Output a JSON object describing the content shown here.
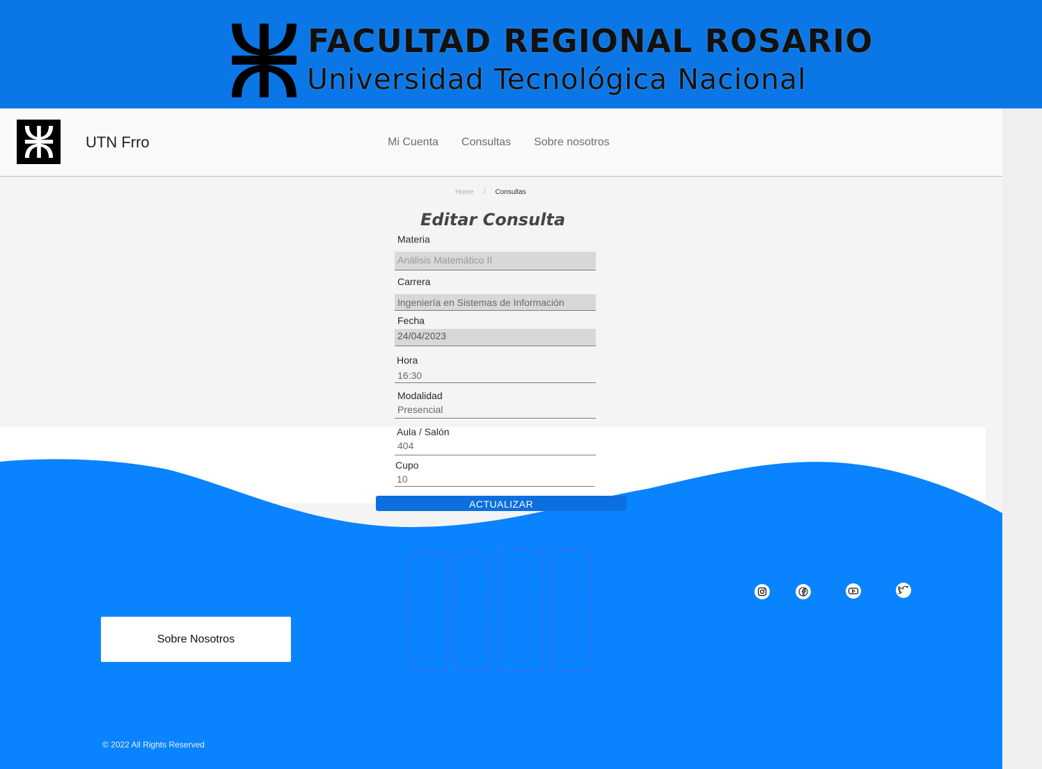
{
  "banner": {
    "line1": "FACULTAD REGIONAL ROSARIO",
    "line2": "Universidad Tecnológica Nacional"
  },
  "navbar": {
    "brand": "UTN Frro",
    "links": [
      "Mi Cuenta",
      "Consultas",
      "Sobre nosotros"
    ]
  },
  "breadcrumb": {
    "home": "Home",
    "separator": "/",
    "current": "Consultas"
  },
  "form": {
    "title": "Editar Consulta",
    "fields": {
      "materia": {
        "label": "Materia",
        "value": "Análisis Matemático II"
      },
      "carrera": {
        "label": "Carrera",
        "value": "Ingeniería en Sistemas de Información"
      },
      "fecha": {
        "label": "Fecha",
        "value": "24/04/2023"
      },
      "hora": {
        "label": "Hora",
        "value": "16:30"
      },
      "modalidad": {
        "label": "Modalidad",
        "value": "Presencial"
      },
      "aula": {
        "label": "Aula / Salón",
        "value": "404"
      },
      "cupo": {
        "label": "Cupo",
        "value": "10"
      }
    },
    "submit_label": "ACTUALIZAR"
  },
  "footer": {
    "about_label": "Sobre Nosotros",
    "copyright": "© 2022 All Rights Reserved",
    "social_icons": [
      "instagram-icon",
      "facebook-icon",
      "youtube-icon",
      "twitter-icon"
    ]
  },
  "colors": {
    "brand_blue": "#0b77e6",
    "footer_blue": "#0a83fe",
    "button_blue": "#0b6fe0"
  }
}
